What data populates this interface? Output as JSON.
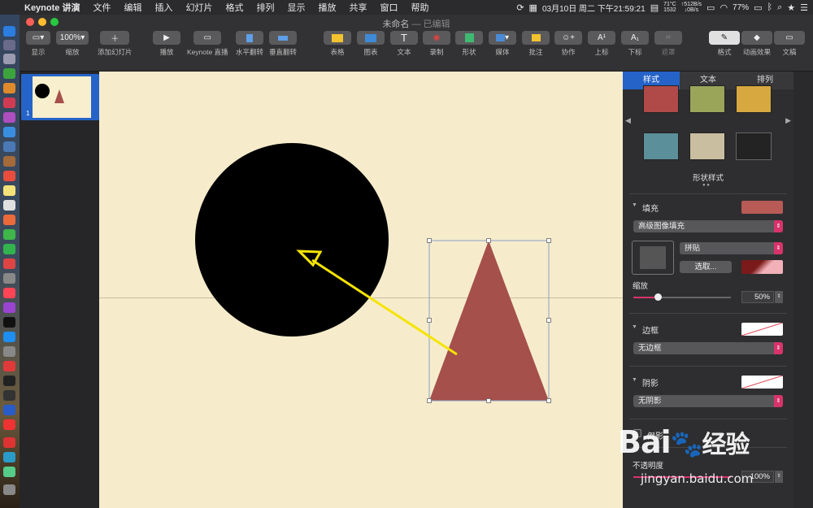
{
  "menubar": {
    "app_name": "Keynote 讲演",
    "items": [
      "文件",
      "编辑",
      "插入",
      "幻灯片",
      "格式",
      "排列",
      "显示",
      "播放",
      "共享",
      "窗口",
      "帮助"
    ],
    "datetime": "03月10日 周二 下午21:59:21",
    "temp": "71°C",
    "temp2": "1532",
    "net_up": "↑512B/s",
    "net_down": "↓0B/s",
    "battery": "77%"
  },
  "window": {
    "title": "未命名",
    "status": "— 已编辑"
  },
  "toolbar": {
    "view": "显示",
    "zoom_value": "100%",
    "zoom": "缩放",
    "add_slide": "添加幻灯片",
    "play": "播放",
    "keynote_live": "Keynote 直播",
    "flip_h": "水平翻转",
    "flip_v": "垂直翻转",
    "table": "表格",
    "chart": "图表",
    "text": "文本",
    "record": "录制",
    "shape": "形状",
    "media": "媒体",
    "comment": "批注",
    "collab": "协作",
    "superscript": "上标",
    "subscript": "下标",
    "mask": "遮罩",
    "format": "格式",
    "animate": "动画效果",
    "document": "文稿"
  },
  "navigator": {
    "slide_number": "1"
  },
  "inspector": {
    "tabs": [
      "样式",
      "文本",
      "排列"
    ],
    "shape_styles_label": "形状样式",
    "swatch_colors": [
      "#b04a48",
      "#9aa55a",
      "#d6a83f",
      "#5b8f9a",
      "#c9bfa0",
      "#232323"
    ],
    "fill_label": "填充",
    "fill_color": "#b85a56",
    "fill_type": "高级图像填充",
    "tile_option": "拼贴",
    "choose_button": "选取...",
    "scale_label": "缩放",
    "scale_value": "50%",
    "scale_level": 0.25,
    "border_label": "边框",
    "border_value": "无边框",
    "shadow_label": "阴影",
    "shadow_value": "无阴影",
    "reflection_label": "倒影",
    "opacity_label": "不透明度",
    "opacity_value": "100%"
  },
  "colors": {
    "accent_blue": "#2563c8",
    "pink": "#d8336a",
    "triangle": "#a5504b",
    "canvas": "#f6eccc",
    "arrow": "#f5e400"
  },
  "watermark": {
    "brand": "Bai",
    "brand2": "经验",
    "url": "jingyan.baidu.com"
  }
}
